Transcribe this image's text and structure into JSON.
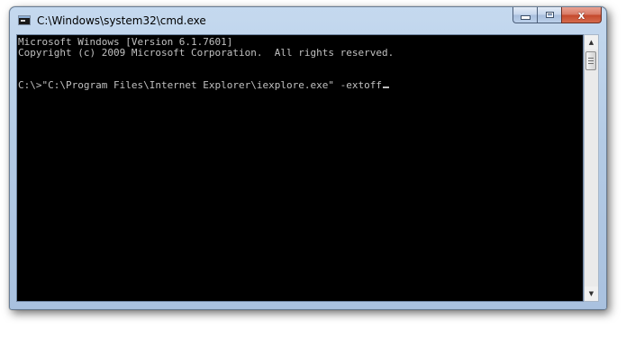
{
  "window": {
    "title": "C:\\Windows\\system32\\cmd.exe",
    "app_icon": "cmd-icon"
  },
  "caption_buttons": {
    "minimize_icon": "minimize-icon",
    "maximize_icon": "maximize-icon",
    "close_icon": "close-icon",
    "close_glyph": "x"
  },
  "console": {
    "lines": [
      "Microsoft Windows [Version 6.1.7601]",
      "Copyright (c) 2009 Microsoft Corporation.  All rights reserved.",
      "",
      "",
      "C:\\>\"C:\\Program Files\\Internet Explorer\\iexplore.exe\" -extoff"
    ],
    "text_color": "#c0c0c0",
    "background_color": "#000000"
  },
  "scrollbar": {
    "up_glyph": "▲",
    "down_glyph": "▼",
    "up_icon": "arrow-up-icon",
    "down_icon": "arrow-down-icon"
  }
}
